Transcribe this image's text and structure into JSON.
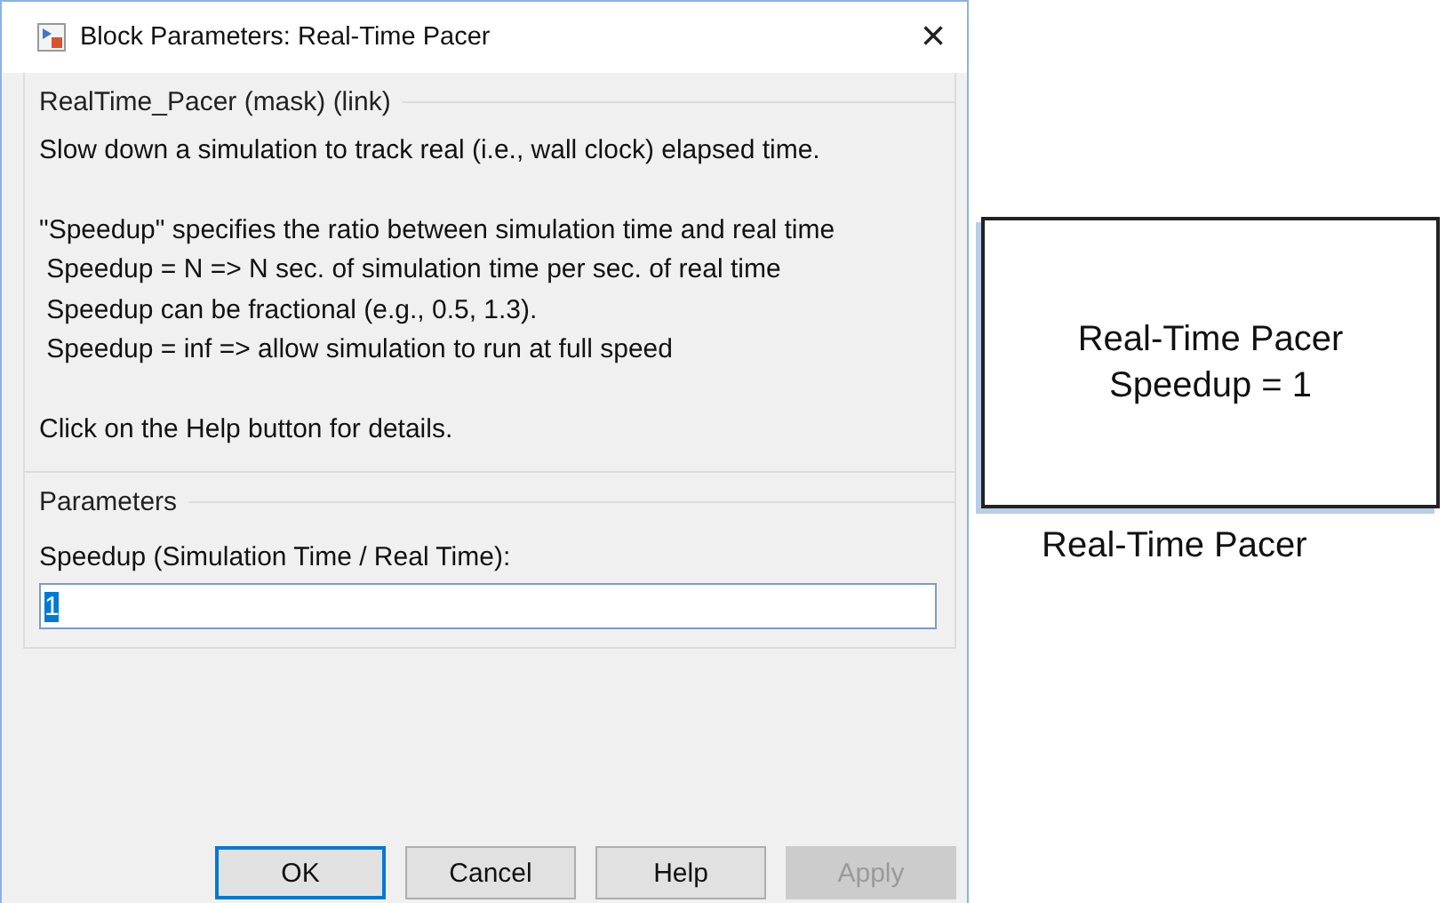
{
  "window": {
    "title": "Block Parameters: Real-Time Pacer",
    "close": "×"
  },
  "mask_group": {
    "title": "RealTime_Pacer (mask) (link)",
    "paragraphs": [
      [
        "Slow down a simulation to track real (i.e., wall clock) elapsed time."
      ],
      [
        "\"Speedup\" specifies the ratio between simulation time and real time",
        " Speedup = N => N sec. of simulation time per sec. of real time",
        " Speedup can be fractional (e.g., 0.5, 1.3).",
        " Speedup = inf => allow simulation to run at full speed"
      ],
      [
        "Click on the Help button for details."
      ]
    ]
  },
  "parameters_group": {
    "title": "Parameters",
    "field_label": "Speedup (Simulation Time / Real Time):",
    "field_value": "1",
    "value_selected": true
  },
  "buttons": [
    {
      "label": "OK",
      "default": true,
      "disabled": false
    },
    {
      "label": "Cancel",
      "default": false,
      "disabled": false
    },
    {
      "label": "Help",
      "default": false,
      "disabled": false
    },
    {
      "label": "Apply",
      "default": false,
      "disabled": true
    }
  ],
  "block": {
    "lines": [
      "Real-Time Pacer",
      "Speedup = 1"
    ],
    "name": "Real-Time Pacer"
  }
}
